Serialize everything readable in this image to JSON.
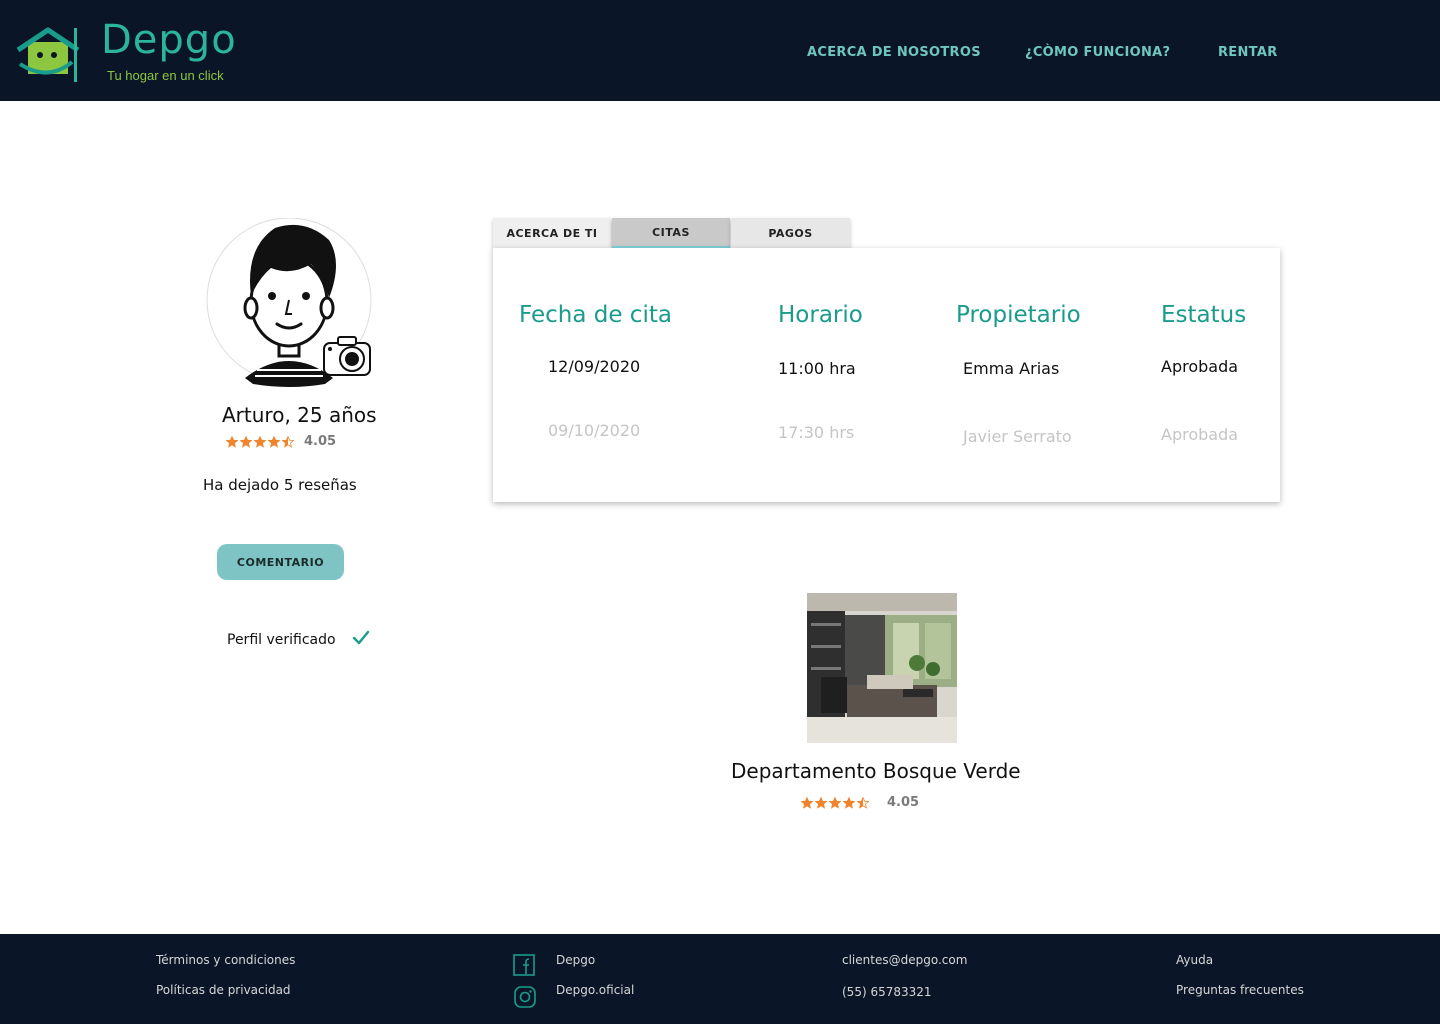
{
  "header": {
    "brand": "Depgo",
    "tagline": "Tu hogar en un click",
    "nav": [
      "ACERCA DE NOSOTROS",
      "¿CÒMO FUNCIONA?",
      "RENTAR"
    ]
  },
  "profile": {
    "name": "Arturo, 25 años",
    "rating": "4.05",
    "rating_value": 4.5,
    "reviews_text": "Ha dejado 5 reseñas",
    "comment_button": "COMENTARIO",
    "verified_text": "Perfil verificado"
  },
  "tabs": [
    {
      "label": "ACERCA DE TI",
      "active": false
    },
    {
      "label": "CITAS",
      "active": true
    },
    {
      "label": "PAGOS",
      "active": false
    }
  ],
  "appointments": {
    "headers": [
      "Fecha de cita",
      "Horario",
      "Propietario",
      "Estatus"
    ],
    "rows": [
      {
        "date": "12/09/2020",
        "time": "11:00 hra",
        "owner": "Emma Arias",
        "status": "Aprobada"
      },
      {
        "date": "09/10/2020",
        "time": "17:30 hrs",
        "owner": "Javier Serrato",
        "status": "Aprobada"
      }
    ]
  },
  "property": {
    "title": "Departamento Bosque Verde",
    "rating": "4.05",
    "rating_value": 4.5
  },
  "footer": {
    "terms": "Términos y condiciones",
    "privacy": "Políticas  de privacidad",
    "facebook": "Depgo",
    "instagram": "Depgo.oficial",
    "email": "clientes@depgo.com",
    "phone": "(55) 65783321",
    "help": "Ayuda",
    "faq": "Preguntas frecuentes"
  },
  "colors": {
    "header_bg": "#0a1628",
    "brand": "#2bb59a",
    "tagline": "#8dc63f",
    "nav": "#6fc6be",
    "table_header": "#1a9c8c",
    "star": "#f0842c",
    "button": "#7fc4c4"
  }
}
